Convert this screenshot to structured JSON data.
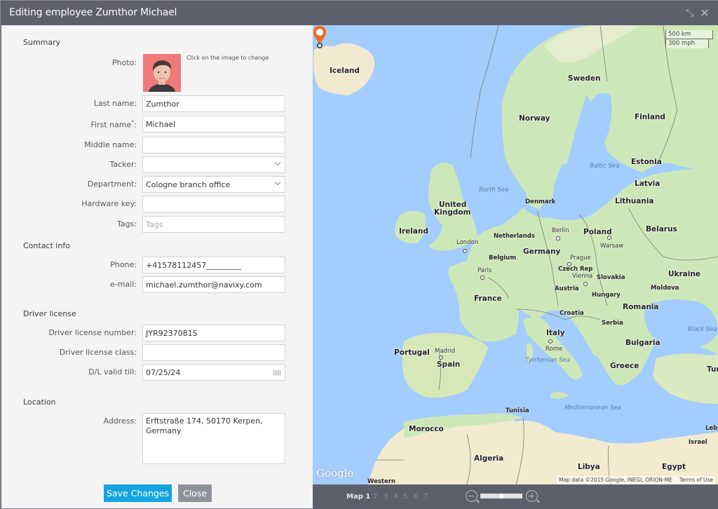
{
  "dialog": {
    "title": "Editing employee Zumthor Michael",
    "expand_icon": "expand-arrows-icon",
    "close_icon": "close-x-icon"
  },
  "form": {
    "sections": {
      "summary": "Summary",
      "contact": "Contact info",
      "license": "Driver license",
      "location": "Location"
    },
    "photo": {
      "label": "Photo:",
      "hint": "Click on the image to change"
    },
    "fields": {
      "last_name": {
        "label": "Last name:",
        "value": "Zumthor"
      },
      "first_name": {
        "label": "First name",
        "required_mark": "*",
        "colon": ":",
        "value": "Michael"
      },
      "middle_name": {
        "label": "Middle name:",
        "value": ""
      },
      "tracker": {
        "label": "Tacker:",
        "value": ""
      },
      "department": {
        "label": "Department:",
        "value": "Cologne branch office"
      },
      "hardware_key": {
        "label": "Hardware key:",
        "value": ""
      },
      "tags": {
        "label": "Tags:",
        "value": "",
        "placeholder": "Tags"
      },
      "phone": {
        "label": "Phone:",
        "value": "+41578112457_________"
      },
      "email": {
        "label": "e-mail:",
        "value": "michael.zumthor@navixy.com"
      },
      "license_number": {
        "label": "Driver license number:",
        "value": "JYR9237081S"
      },
      "license_class": {
        "label": "Driver license class:",
        "value": ""
      },
      "license_valid": {
        "label": "D/L valid till:",
        "value": "07/25/24"
      },
      "address": {
        "label": "Address:",
        "line1": "Erftstraße 174, 50170 Kerpen,",
        "line2": "Germany"
      }
    },
    "buttons": {
      "save": "Save Changes",
      "close": "Close"
    }
  },
  "map": {
    "scale": {
      "metric": "500 km",
      "imperial": "300 mph"
    },
    "countries": [
      {
        "name": "Iceland"
      },
      {
        "name": "Sweden"
      },
      {
        "name": "Norway"
      },
      {
        "name": "Finland"
      },
      {
        "name": "Estonia"
      },
      {
        "name": "Latvia"
      },
      {
        "name": "Lithuania"
      },
      {
        "name": "Denmark"
      },
      {
        "name": "United"
      },
      {
        "name": "Kingdom"
      },
      {
        "name": "Ireland"
      },
      {
        "name": "Netherlands"
      },
      {
        "name": "Belgium"
      },
      {
        "name": "Germany"
      },
      {
        "name": "Poland"
      },
      {
        "name": "Belarus"
      },
      {
        "name": "Czech Rep"
      },
      {
        "name": "Slovakia"
      },
      {
        "name": "Austria"
      },
      {
        "name": "Hungary"
      },
      {
        "name": "Ukraine"
      },
      {
        "name": "Moldova"
      },
      {
        "name": "Romania"
      },
      {
        "name": "France"
      },
      {
        "name": "Croatia"
      },
      {
        "name": "Serbia"
      },
      {
        "name": "Bulgaria"
      },
      {
        "name": "Italy"
      },
      {
        "name": "Portugal"
      },
      {
        "name": "Spain"
      },
      {
        "name": "Greece"
      },
      {
        "name": "Turkey"
      },
      {
        "name": "Tunisia"
      },
      {
        "name": "Morocco"
      },
      {
        "name": "Algeria"
      },
      {
        "name": "Libya"
      },
      {
        "name": "Egypt"
      },
      {
        "name": "Lebanon"
      },
      {
        "name": "Israel"
      },
      {
        "name": "Western"
      }
    ],
    "cities": [
      "London",
      "Paris",
      "Berlin",
      "Warsaw",
      "Prague",
      "Vienna",
      "Madrid",
      "Rome"
    ],
    "seas": [
      "North Sea",
      "Baltic Sea",
      "Black Sea",
      "Tyrrhenian Sea",
      "Mediterranean Sea"
    ],
    "marker_color": "#f26b21",
    "logo": "Google",
    "attribution": "Map data ©2015 Google, INEGI, ORION-ME",
    "terms": "Terms of Use"
  },
  "mapbar": {
    "tabs": [
      "Map 1",
      "2",
      "3",
      "4",
      "5",
      "6",
      "7"
    ],
    "active_tab": 0,
    "zoom_level_fraction": 0.5
  },
  "colors": {
    "titlebar": "#5d606c",
    "save_button": "#14a5e0",
    "close_button": "#8f929a",
    "form_bg": "#f4f4f4",
    "sea": "#a3ccff",
    "land": "#cde8b8"
  }
}
